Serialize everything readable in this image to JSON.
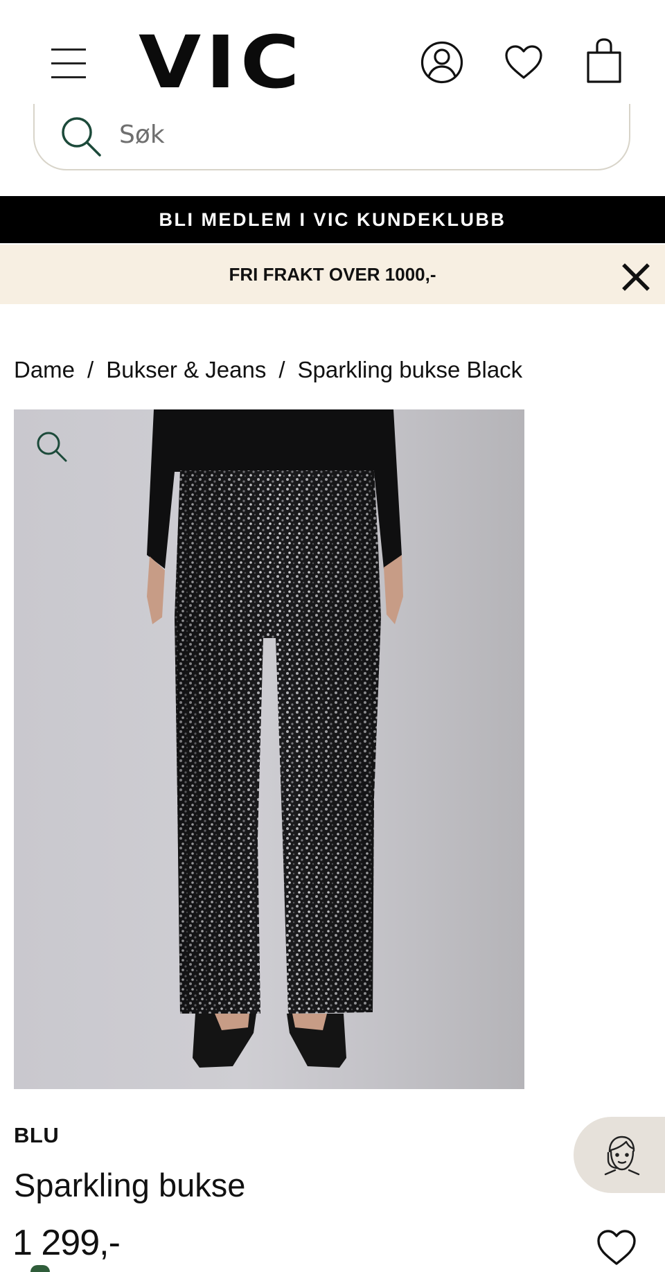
{
  "header": {
    "logo": "VIC"
  },
  "search": {
    "placeholder": "Søk"
  },
  "banners": {
    "member": "BLI MEDLEM I VIC KUNDEKLUBB",
    "shipping": "FRI FRAKT OVER 1000,-"
  },
  "breadcrumb": [
    "Dame",
    "Bukser & Jeans",
    "Sparkling bukse Black"
  ],
  "breadcrumb_separator": "/",
  "product": {
    "brand": "BLU",
    "title": "Sparkling bukse",
    "price": "1 299,-"
  },
  "icons": {
    "menu": "hamburger-menu-icon",
    "account": "user-icon",
    "wishlist": "heart-icon",
    "cart": "shopping-bag-icon",
    "search": "search-icon",
    "close": "close-icon",
    "zoom": "zoom-icon",
    "support": "customer-support-icon"
  },
  "colors": {
    "member_bar": "#000000",
    "shipping_bar": "#f7efe2",
    "support_bg": "#e6e1da",
    "accent_green": "#2f5d3a"
  }
}
